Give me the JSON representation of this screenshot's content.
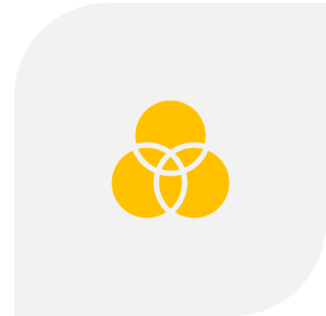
{
  "tile": {
    "background_color": "#f2f2f3"
  },
  "icon": {
    "name": "venn-three-circles-icon",
    "fill_color": "#ffc000",
    "stroke_color": "#f2f2f3"
  }
}
